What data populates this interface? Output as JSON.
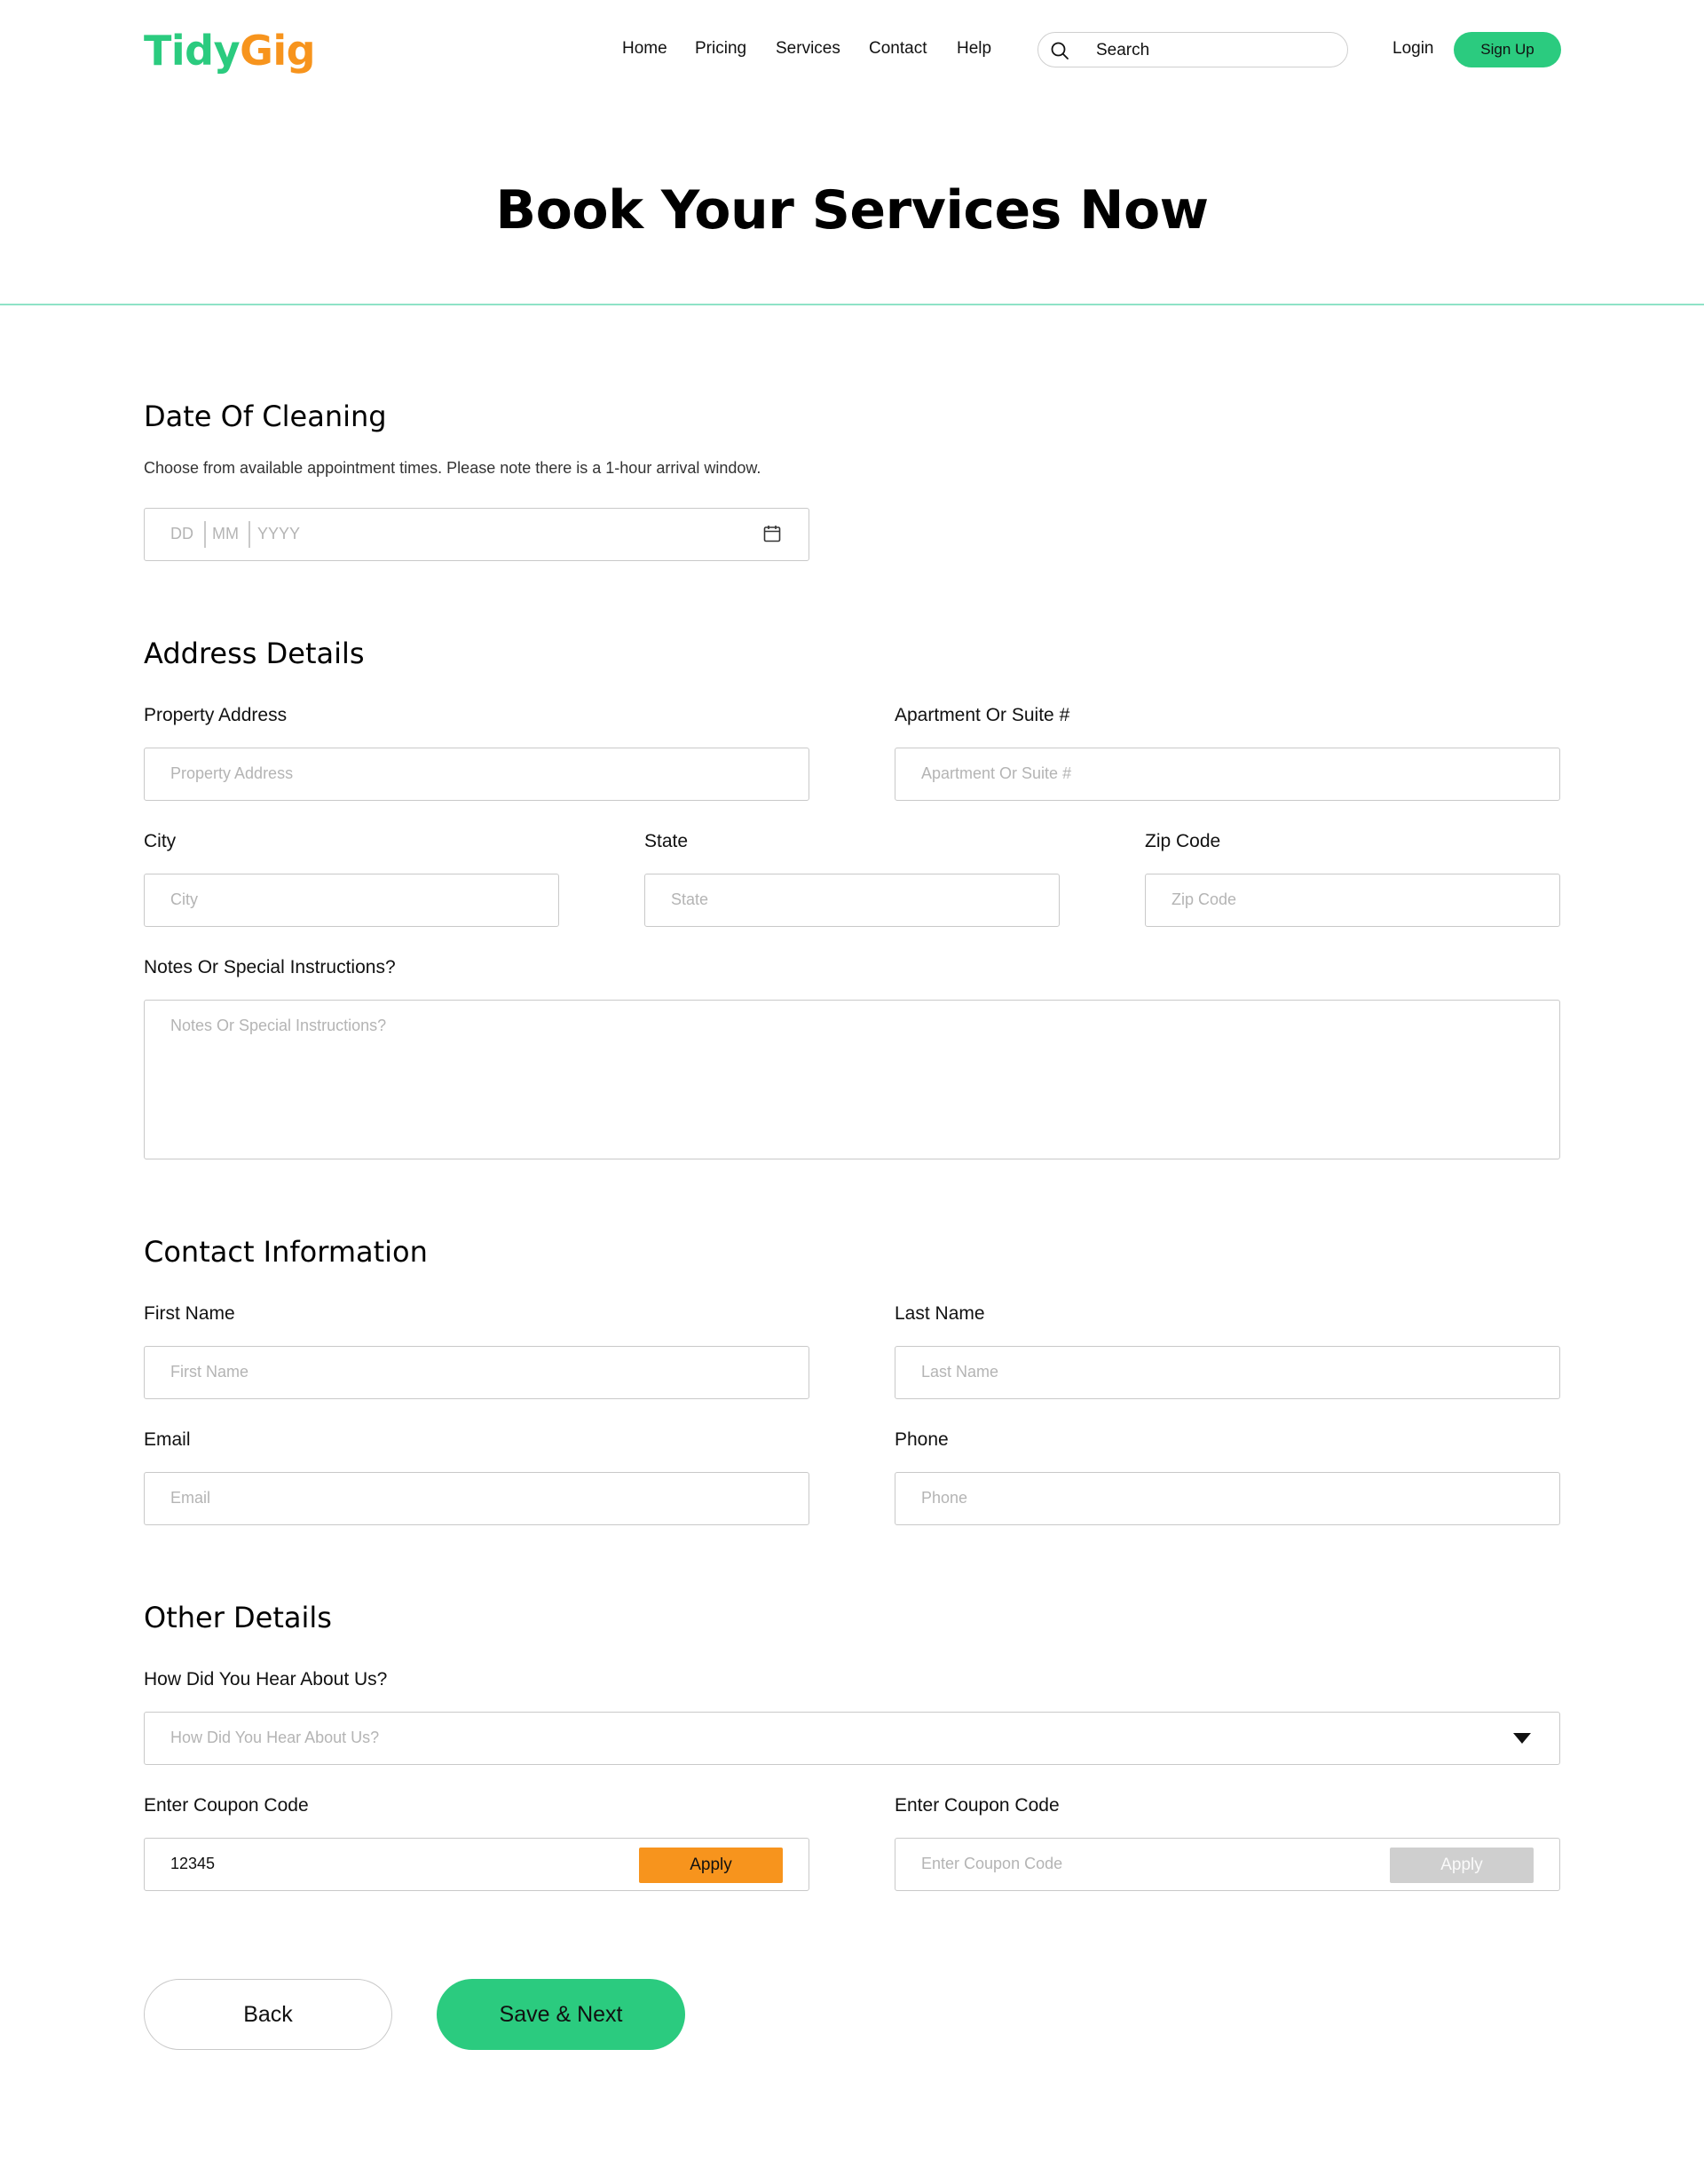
{
  "brand": {
    "part1": "Tidy",
    "part2": "Gig"
  },
  "nav": {
    "items": [
      "Home",
      "Pricing",
      "Services",
      "Contact",
      "Help"
    ]
  },
  "search": {
    "placeholder": "Search",
    "icon": "search-icon"
  },
  "auth": {
    "login": "Login",
    "signup": "Sign Up"
  },
  "page": {
    "title": "Book Your Services Now"
  },
  "colors": {
    "brand_green": "#2bcb7f",
    "brand_orange": "#f7941d",
    "divider": "#8fe3c7"
  },
  "date_section": {
    "title": "Date Of Cleaning",
    "helper": "Choose from available appointment times. Please note there is a 1-hour arrival window.",
    "dd": "DD",
    "mm": "MM",
    "yyyy": "YYYY",
    "icon": "calendar-icon"
  },
  "address": {
    "title": "Address Details",
    "property_label": "Property Address",
    "property_placeholder": "Property Address",
    "apt_label": "Apartment Or Suite #",
    "apt_placeholder": "Apartment Or Suite #",
    "city_label": "City",
    "city_placeholder": "City",
    "state_label": "State",
    "state_placeholder": "State",
    "zip_label": "Zip Code",
    "zip_placeholder": "Zip Code",
    "notes_label": "Notes Or Special Instructions?",
    "notes_placeholder": "Notes Or Special Instructions?"
  },
  "contact": {
    "title": "Contact Information",
    "first_label": "First Name",
    "first_placeholder": "First Name",
    "last_label": "Last Name",
    "last_placeholder": "Last Name",
    "email_label": "Email",
    "email_placeholder": "Email",
    "phone_label": "Phone",
    "phone_placeholder": "Phone"
  },
  "other": {
    "title": "Other Details",
    "hear_label": "How Did You Hear About Us?",
    "hear_placeholder": "How Did You Hear About Us?",
    "coupon1_label": "Enter Coupon Code",
    "coupon1_value": "12345",
    "coupon1_button": "Apply",
    "coupon2_label": "Enter Coupon Code",
    "coupon2_placeholder": "Enter Coupon Code",
    "coupon2_button": "Apply"
  },
  "actions": {
    "back": "Back",
    "next": "Save & Next"
  }
}
